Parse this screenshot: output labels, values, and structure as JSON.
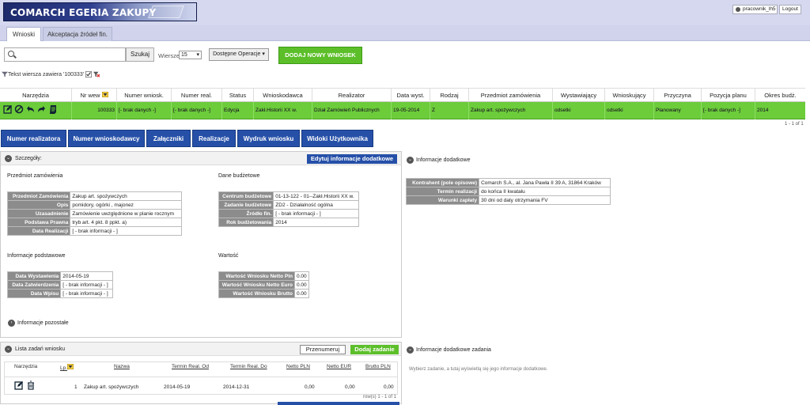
{
  "header": {
    "app_title": "COMARCH EGERIA ZAKUPY",
    "user": "pracownik_lh5",
    "logout_label": "Logout"
  },
  "tabs": [
    {
      "label": "Wnioski",
      "active": true
    },
    {
      "label": "Akceptacja źródeł fin.",
      "active": false
    }
  ],
  "toolbar": {
    "search_value": "",
    "search_label": "Szukaj",
    "rows_label": "Wiersze",
    "rows_value": "15",
    "operations_label": "Dostępne Operacje",
    "add_label": "DODAJ NOWY WNIOSEK",
    "filter_text": "Tekst wiersza zawiera '100333'"
  },
  "grid": {
    "headers": [
      "Narzędzia",
      "Nr wew",
      "Numer wniosk.",
      "Numer real.",
      "Status",
      "Wnioskodawca",
      "Realizator",
      "Data wyst.",
      "Rodzaj",
      "Przedmiot zamówienia",
      "Wystawiający",
      "Wnioskujący",
      "Przyczyna",
      "Pozycja planu",
      "Okres budż."
    ],
    "row": [
      "",
      "100333",
      "[- brak danych -]",
      "[- brak danych -]",
      "Edycja",
      "Zakł.Historii XX w.",
      "Dział Zamówień Publicznych",
      "19-05-2014",
      "Z",
      "Zakup art. spożywczych",
      "odsetki",
      "odsetki",
      "Planowany",
      "[- brak danych -]",
      "2014"
    ],
    "pager": "1 - 1 of 1",
    "row_color": "#6ccc3a"
  },
  "actions": [
    "Numer realizatora",
    "Numer wnioskodawcy",
    "Załączniki",
    "Realizacje",
    "Wydruk wniosku",
    "Widoki Użytkownika"
  ],
  "details": {
    "title": "Szczegóły:",
    "edit_label": "Edytuj informacje dodatkowe",
    "przedmiot_title": "Przedmiot zamówienia",
    "przedmiot": [
      {
        "k": "Przedmiot Zamówienia",
        "v": "Zakup art. spożywczych"
      },
      {
        "k": "Opis",
        "v": "pomidory, ogórki , majonez"
      },
      {
        "k": "Uzasadnienie",
        "v": "Zamówienie uwzględnione w planie rocznym"
      },
      {
        "k": "Podstawa Prawna",
        "v": "tryb art. 4 pkt. 8 ppkt. a)"
      },
      {
        "k": "Data Realizacji",
        "v": "[ - brak informacji - ]"
      }
    ],
    "budzet_title": "Dane budżetowe",
    "budzet": [
      {
        "k": "Centrum budżetowe",
        "v": "01-13-122 - 01--Zakł.Historii XX w."
      },
      {
        "k": "Zadanie budżetowe",
        "v": "ZD2 - Działalność ogólna"
      },
      {
        "k": "Źródło fin.",
        "v": "[ - brak informacji - ]"
      },
      {
        "k": "Rok budżetowania",
        "v": "2014"
      }
    ],
    "podst_title": "Informacje podstawowe",
    "podst": [
      {
        "k": "Data Wystawienia",
        "v": "2014-05-19"
      },
      {
        "k": "Data Zatwierdzenia",
        "v": "[ - brak informacji - ]"
      },
      {
        "k": "Data Wpisu",
        "v": "[ - brak informacji - ]"
      }
    ],
    "wartosc_title": "Wartość",
    "wartosc": [
      {
        "k": "Wartość Wniosku Netto Pln",
        "v": "0.00"
      },
      {
        "k": "Wartość Wniosku Netto Euro",
        "v": "0.00"
      },
      {
        "k": "Wartość Wniosku Brutto",
        "v": "0.00"
      }
    ],
    "other_label": "Informacje pozostałe"
  },
  "info_dodatkowe": {
    "title": "Informacje dodatkowe",
    "rows": [
      {
        "k": "Kontrahent (pole opisowe)",
        "v": "Comarch S.A., al. Jana Pawła II 39 A, 31864 Kraków"
      },
      {
        "k": "Termin realizacji",
        "v": "do końca II kwatału"
      },
      {
        "k": "Warunki zapłaty",
        "v": "30 dni od daty otrzymania FV"
      }
    ]
  },
  "tasks": {
    "title": "Lista zadań wniosku",
    "renumber_label": "Przenumeruj",
    "add_label": "Dodaj zadanie",
    "headers": [
      "Narzędzia",
      "Lp.",
      "Nazwa",
      "Termin Real. Od",
      "Termin Real. Do",
      "Netto PLN",
      "Netto EUR",
      "Brutto PLN"
    ],
    "row": [
      "",
      "1",
      "Zakup art. spożywczych",
      "2014-05-19",
      "2014-12-31",
      "0,00",
      "0,00",
      "0,00"
    ],
    "pager": "row(s) 1 - 1 of 1"
  },
  "task_info": {
    "title": "Informacje dodatkowe zadania",
    "hint": "Wybierz zadanie, a tutaj wyświetlą się jego informacje dodatkowe."
  }
}
